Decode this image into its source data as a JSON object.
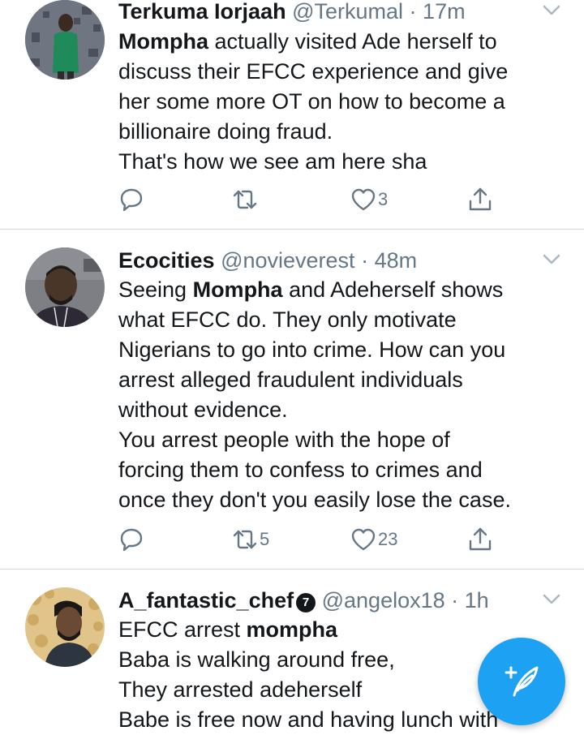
{
  "colors": {
    "accent": "#1da1f2",
    "text": "#14171a",
    "muted": "#657786",
    "divider": "#ccd6dd"
  },
  "tweets": [
    {
      "name": "Terkuma Iorjaah",
      "handle": "@Terkumal",
      "sep": " · ",
      "time": "17m",
      "lines": [
        {
          "bold": "Mompha",
          "text": " actually visited Ade herself to"
        },
        {
          "text": "discuss their EFCC experience and give"
        },
        {
          "text": "her some more OT on how to become a"
        },
        {
          "text": "billionaire doing fraud."
        },
        {
          "text": "That's how we see am here sha"
        }
      ],
      "retweets": "",
      "likes": "3"
    },
    {
      "name": "Ecocities",
      "handle": "@novieverest",
      "sep": " · ",
      "time": "48m",
      "lines": [
        {
          "pre": "Seeing ",
          "bold": "Mompha",
          "text": " and Adeherself shows"
        },
        {
          "text": "what EFCC do. They only motivate"
        },
        {
          "text": "Nigerians to go into crime. How can you"
        },
        {
          "text": "arrest alleged fraudulent individuals"
        },
        {
          "text": "without evidence."
        },
        {
          "text": "You arrest people with the hope of"
        },
        {
          "text": "forcing them to confess to crimes and"
        },
        {
          "text": "once they don't you easily lose the case."
        }
      ],
      "retweets": "5",
      "likes": "23"
    },
    {
      "name": "A_fantastic_chef",
      "badge": "7",
      "handle": "@angelox18",
      "sep": " · ",
      "time": "1h",
      "lines": [
        {
          "pre": "EFCC arrest ",
          "bold": "mompha",
          "text": ""
        },
        {
          "text": "Baba is walking around free,"
        },
        {
          "text": "They arrested adeherself"
        },
        {
          "text": "Babe is free now and having lunch with"
        }
      ]
    }
  ],
  "icons": {
    "reply": "reply-icon",
    "retweet": "retweet-icon",
    "like": "heart-icon",
    "share": "share-icon",
    "caret": "chevron-down-icon",
    "compose": "compose-tweet-icon"
  }
}
